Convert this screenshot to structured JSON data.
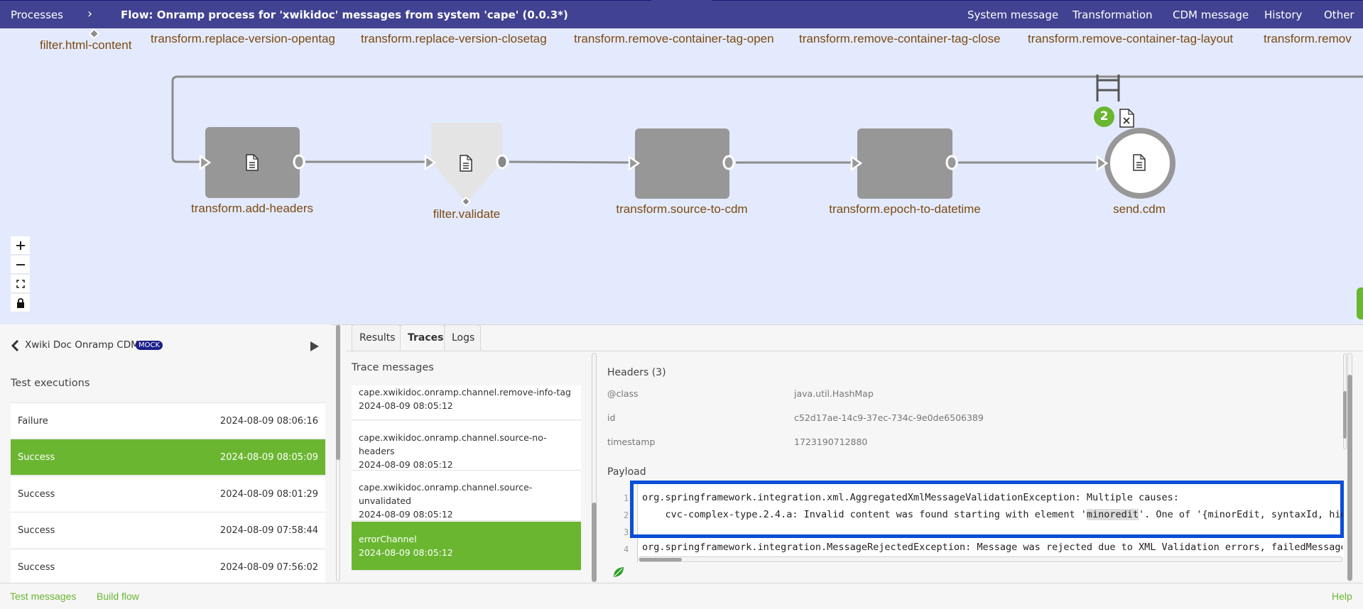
{
  "header": {
    "breadcrumb_root": "Processes",
    "breadcrumb_sep": "›",
    "title": "Flow: Onramp process for 'xwikidoc' messages from system 'cape' (0.0.3*)",
    "nav": [
      "System message",
      "Transformation",
      "CDM message",
      "History",
      "Other"
    ],
    "bg_color": "#414291"
  },
  "flow": {
    "top_labels": [
      "filter.html-content",
      "transform.replace-version-opentag",
      "transform.replace-version-closetag",
      "transform.remove-container-tag-open",
      "transform.remove-container-tag-close",
      "transform.remove-container-tag-layout",
      "transform.remov"
    ],
    "nodes": [
      {
        "label": "transform.add-headers",
        "type": "transformer",
        "icon": "document-icon"
      },
      {
        "label": "filter.validate",
        "type": "filter",
        "icon": "document-icon"
      },
      {
        "label": "transform.source-to-cdm",
        "type": "transformer"
      },
      {
        "label": "transform.epoch-to-datetime",
        "type": "transformer"
      },
      {
        "label": "send.cdm",
        "type": "endpoint",
        "icon": "document-icon"
      }
    ],
    "error_badge_count": "2",
    "zoom_controls": [
      "+",
      "−",
      "fit",
      "lock"
    ]
  },
  "left_panel": {
    "test_name": "Xwiki Doc Onramp CDM",
    "badge": "MOCK",
    "section_title": "Test executions",
    "executions": [
      {
        "status": "Failure",
        "time": "2024-08-09 08:06:16",
        "selected": false
      },
      {
        "status": "Success",
        "time": "2024-08-09 08:05:09",
        "selected": true
      },
      {
        "status": "Success",
        "time": "2024-08-09 08:01:29",
        "selected": false
      },
      {
        "status": "Success",
        "time": "2024-08-09 07:58:44",
        "selected": false
      },
      {
        "status": "Success",
        "time": "2024-08-09 07:56:02",
        "selected": false
      }
    ]
  },
  "tabs": [
    "Results",
    "Traces",
    "Logs"
  ],
  "active_tab": "Traces",
  "traces": {
    "title": "Trace messages",
    "items": [
      {
        "channel": "cape.xwikidoc.onramp.channel.remove-info-tag",
        "time": "2024-08-09 08:05:12"
      },
      {
        "channel": "cape.xwikidoc.onramp.channel.source-no-headers",
        "time": "2024-08-09 08:05:12"
      },
      {
        "channel": "cape.xwikidoc.onramp.channel.source-unvalidated",
        "time": "2024-08-09 08:05:12"
      },
      {
        "channel": "errorChannel",
        "time": "2024-08-09 08:05:12",
        "selected": true
      }
    ]
  },
  "details": {
    "headers_title": "Headers (3)",
    "headers": [
      {
        "key": "@class",
        "value": "java.util.HashMap"
      },
      {
        "key": "id",
        "value": "c52d17ae-14c9-37ec-734c-9e0de6506389"
      },
      {
        "key": "timestamp",
        "value": "1723190712880"
      }
    ],
    "payload_title": "Payload",
    "payload_lines": [
      {
        "n": "1",
        "text": "org.springframework.integration.xml.AggregatedXmlMessageValidationException: Multiple causes:"
      },
      {
        "n": "2",
        "pre": "    cvc-complex-type.2.4.a: Invalid content was found starting with element '",
        "hl": "minoredit",
        "post": "'. One of '{minorEdit, syntaxId, hidde"
      },
      {
        "n": "3",
        "text": ""
      },
      {
        "n": "4",
        "text": "org.springframework.integration.MessageRejectedException: Message was rejected due to XML Validation errors, failedMessage=("
      }
    ]
  },
  "footer": {
    "links": [
      "Test messages",
      "Build flow"
    ],
    "help": "Help"
  },
  "colors": {
    "accent_green": "#6ab631",
    "highlight_box": "#0a4fd6",
    "label_brown": "#7a4a12"
  }
}
